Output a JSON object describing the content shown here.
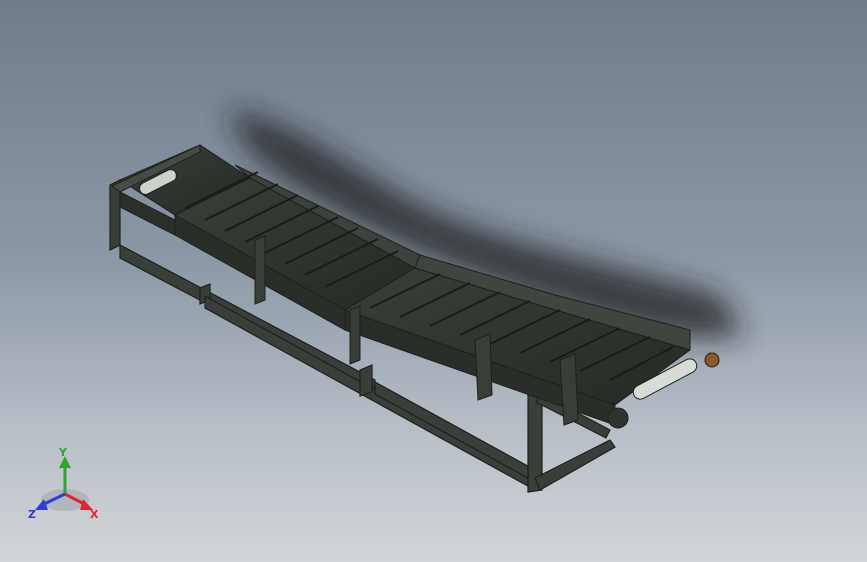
{
  "viewport": {
    "background_top": "#6f7c8c",
    "background_bottom": "#d2d5d8",
    "model_color": "#2f332d",
    "shadow_color": "#1b1d1f"
  },
  "triad": {
    "x_label": "X",
    "y_label": "Y",
    "z_label": "Z",
    "x_color": "#e0262a",
    "y_color": "#2ea52b",
    "z_color": "#2a3fd6"
  }
}
